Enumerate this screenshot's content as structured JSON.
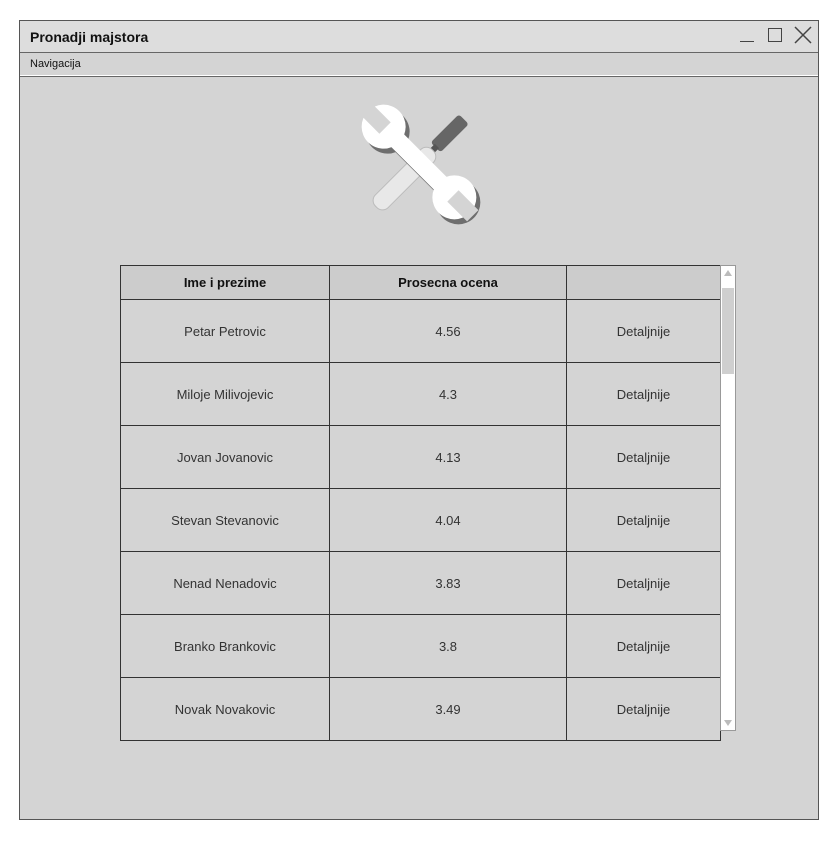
{
  "window": {
    "title": "Pronadji majstora",
    "controls": [
      "minimize-icon",
      "maximize-icon",
      "close-icon"
    ]
  },
  "menu": {
    "items": [
      {
        "label": "Navigacija"
      }
    ]
  },
  "logo": {
    "icon": "wrench-screwdriver-icon"
  },
  "table": {
    "headers": [
      "Ime i prezime",
      "Prosecna ocena",
      ""
    ],
    "rows": [
      {
        "name": "Petar Petrovic",
        "rating": "4.56",
        "action": "Detaljnije"
      },
      {
        "name": "Miloje Milivojevic",
        "rating": "4.3",
        "action": "Detaljnije"
      },
      {
        "name": "Jovan Jovanovic",
        "rating": "4.13",
        "action": "Detaljnije"
      },
      {
        "name": "Stevan Stevanovic",
        "rating": "4.04",
        "action": "Detaljnije"
      },
      {
        "name": "Nenad Nenadovic",
        "rating": "3.83",
        "action": "Detaljnije"
      },
      {
        "name": "Branko Brankovic",
        "rating": "3.8",
        "action": "Detaljnije"
      },
      {
        "name": "Novak Novakovic",
        "rating": "3.49",
        "action": "Detaljnije"
      }
    ]
  },
  "colors": {
    "window_bg": "#d4d4d4",
    "header_bg": "#cccccc",
    "border": "#333333"
  }
}
